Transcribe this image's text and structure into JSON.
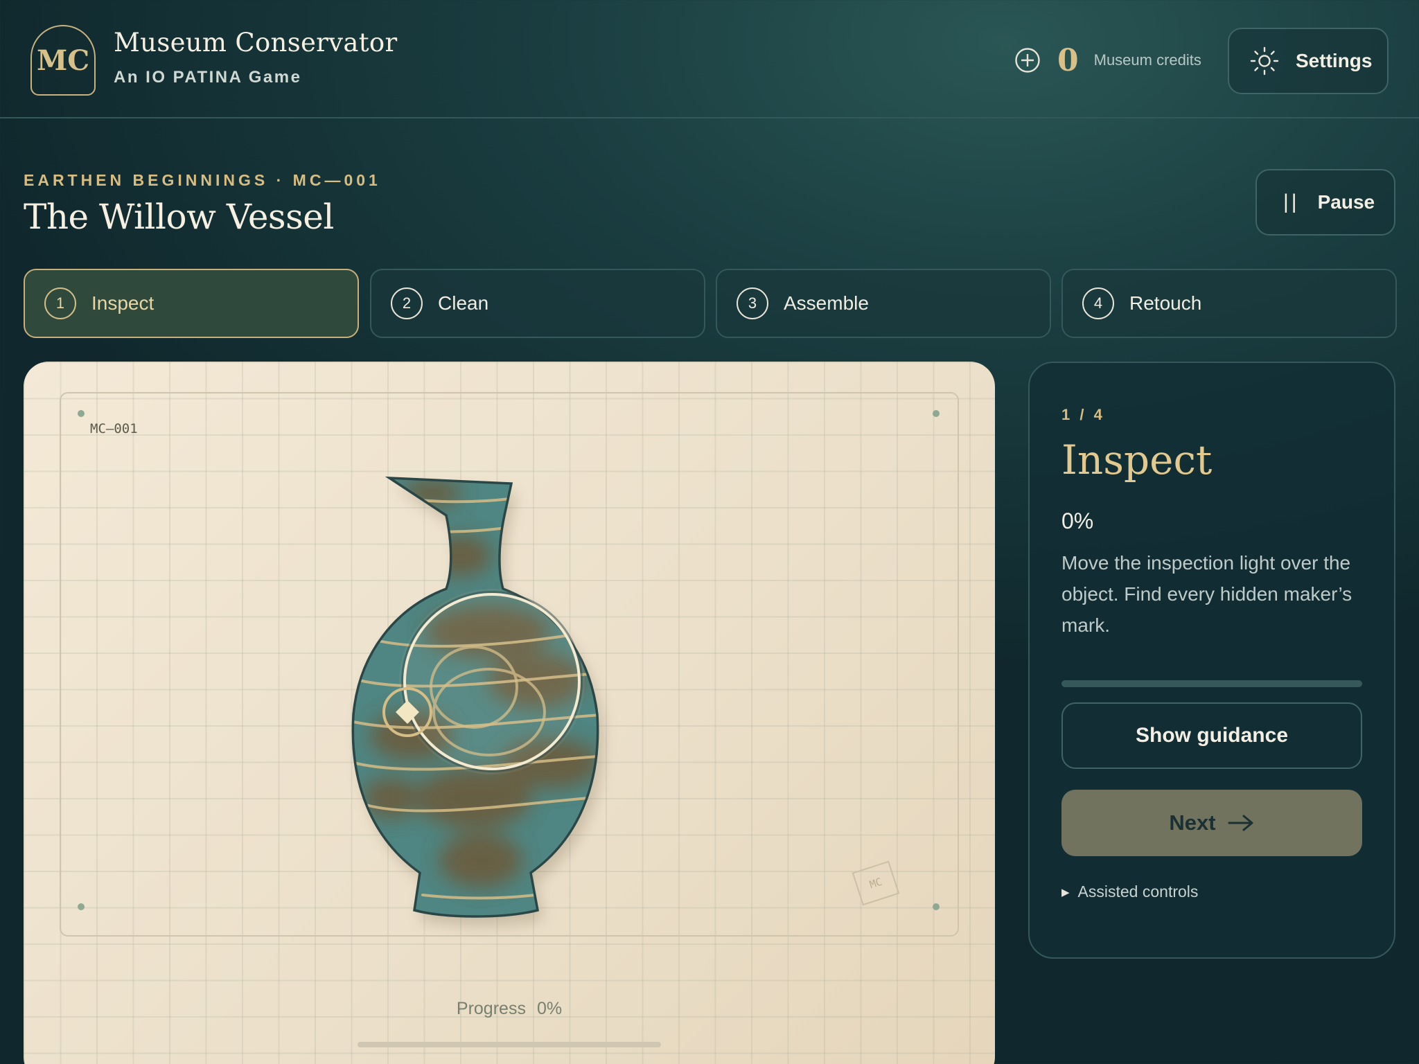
{
  "header": {
    "logo_text": "MC",
    "title": "Museum Conservator",
    "subtitle": "An IO PATINA Game",
    "credits": {
      "icon": "plus-circle-icon",
      "value": "0",
      "label": "Museum credits"
    },
    "settings": {
      "icon": "sun-icon",
      "label": "Settings"
    }
  },
  "level": {
    "eyebrow": "EARTHEN BEGINNINGS · MC—001",
    "title": "The Willow Vessel",
    "pause": {
      "icon_text": "||",
      "label": "Pause"
    }
  },
  "steps": [
    {
      "num": "1",
      "label": "Inspect",
      "active": true
    },
    {
      "num": "2",
      "label": "Clean",
      "active": false
    },
    {
      "num": "3",
      "label": "Assemble",
      "active": false
    },
    {
      "num": "4",
      "label": "Retouch",
      "active": false
    }
  ],
  "workspace": {
    "catalog_id": "MC—001",
    "stamp": "MC",
    "progress_label": "Progress",
    "progress_value": "0%",
    "progress_fraction": 0
  },
  "panel": {
    "step_count": "1 / 4",
    "title": "Inspect",
    "percent": "0%",
    "percent_fraction": 0,
    "description": "Move the inspection light over the object. Find every hidden maker’s mark.",
    "guidance_label": "Show guidance",
    "next_label": "Next",
    "assisted_label": "Assisted controls"
  },
  "colors": {
    "accent_gold": "#d8bd82",
    "panel_bg": "#163a3f",
    "canvas_bg": "#efe4cf",
    "vase_glaze": "#4f8582",
    "next_button": "#71735f"
  }
}
